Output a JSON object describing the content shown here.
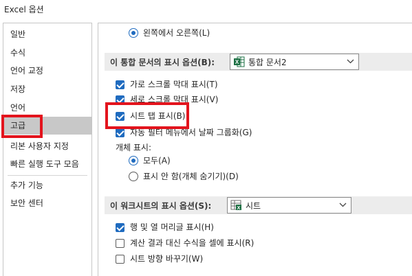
{
  "window": {
    "title": "Excel 옵션"
  },
  "sidebar": {
    "items": [
      {
        "label": "일반"
      },
      {
        "label": "수식"
      },
      {
        "label": "언어 교정"
      },
      {
        "label": "저장"
      },
      {
        "label": "언어"
      },
      {
        "label": "고급",
        "selected": true
      },
      {
        "label": "리본 사용자 지정"
      },
      {
        "label": "빠른 실행 도구 모음"
      },
      {
        "label": "추가 기능"
      },
      {
        "label": "보안 센터"
      }
    ]
  },
  "main": {
    "direction_radio": {
      "label": "왼쪽에서 오른쪽(L)",
      "checked": true
    },
    "workbook_section": {
      "label": "이 통합 문서의 표시 옵션(B):",
      "select_value": "통합 문서2",
      "icon": "excel-workbook-icon"
    },
    "workbook_options": [
      {
        "label": "가로 스크롤 막대 표시(T)",
        "checked": true
      },
      {
        "label": "세로 스크롤 막대 표시(V)",
        "checked": true
      },
      {
        "label": "시트 탭 표시(B)",
        "checked": true
      },
      {
        "label": "자동 필터 메뉴에서 날짜 그룹화(G)",
        "checked": true
      }
    ],
    "objects_label": "개체 표시:",
    "objects_radios": [
      {
        "label": "모두(A)",
        "checked": true
      },
      {
        "label": "표시 안 함(개체 숨기기)(D)",
        "checked": false
      }
    ],
    "worksheet_section": {
      "label": "이 워크시트의 표시 옵션(S):",
      "select_value": "시트",
      "icon": "excel-sheet-icon"
    },
    "worksheet_options": [
      {
        "label": "행 및 열 머리글 표시(H)",
        "checked": true
      },
      {
        "label": "계산 결과 대신 수식을 셀에 표시(R)",
        "checked": false
      },
      {
        "label": "시트 방향 바꾸기(W)",
        "checked": false
      }
    ]
  },
  "colors": {
    "accent": "#1f6bbf",
    "highlight": "#e3141d",
    "selected_bg": "#c8c8c8",
    "section_bg": "#ececec",
    "excel_green": "#1d7044"
  }
}
